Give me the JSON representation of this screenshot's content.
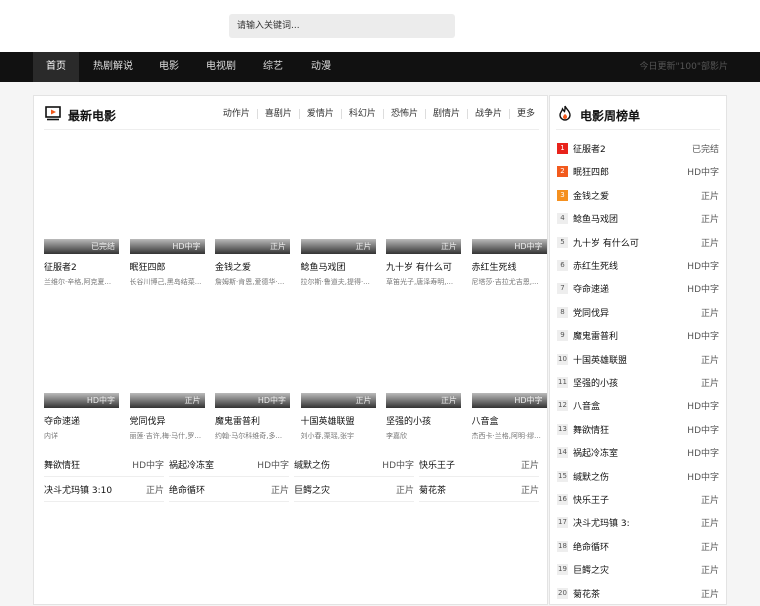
{
  "search": {
    "placeholder": "请输入关键词..."
  },
  "nav": {
    "items": [
      "首页",
      "热剧解说",
      "电影",
      "电视剧",
      "综艺",
      "动漫"
    ],
    "update_text": "今日更新\"100\"部影片"
  },
  "latest": {
    "title": "最新电影",
    "categories": [
      "动作片",
      "喜剧片",
      "爱情片",
      "科幻片",
      "恐怖片",
      "剧情片",
      "战争片",
      "更多"
    ],
    "cards": [
      {
        "title": "征服者2",
        "actors": "兰维尔·辛格,阿克夏...",
        "tag": "已完结"
      },
      {
        "title": "眠狂四郎",
        "actors": "长谷川博己,黑岛结菜...",
        "tag": "HD中字"
      },
      {
        "title": "金钱之爱",
        "actors": "詹姆斯·肯恩,爱德华·...",
        "tag": "正片"
      },
      {
        "title": "鲶鱼马戏团",
        "actors": "拉尔斯·鲁道夫,提得·...",
        "tag": "正片"
      },
      {
        "title": "九十岁 有什么可",
        "actors": "草笛光子,唐泽寿明,...",
        "tag": "正片"
      },
      {
        "title": "赤红生死线",
        "actors": "尼塔莎·吉拉尤吉恩,...",
        "tag": "HD中字"
      },
      {
        "title": "夺命速递",
        "actors": "内详",
        "tag": "HD中字"
      },
      {
        "title": "党同伐异",
        "actors": "丽莲·吉许,梅·马什,罗...",
        "tag": "正片"
      },
      {
        "title": "魔鬼雷普利",
        "actors": "约翰·马尔科维奇,多...",
        "tag": "HD中字"
      },
      {
        "title": "十国英雄联盟",
        "actors": "刘小春,栗瑶,张宇",
        "tag": "正片"
      },
      {
        "title": "坚强的小孩",
        "actors": "李嘉欣",
        "tag": "正片"
      },
      {
        "title": "八音盒",
        "actors": "杰西卡·兰格,阿明·缪...",
        "tag": "HD中字"
      }
    ],
    "list": [
      {
        "name": "舞欲情狂",
        "tag": "HD中字"
      },
      {
        "name": "祸起冷冻室",
        "tag": "HD中字"
      },
      {
        "name": "缄默之伤",
        "tag": "HD中字"
      },
      {
        "name": "快乐王子",
        "tag": "正片"
      },
      {
        "name": "决斗尤玛镇 3:10",
        "tag": "正片"
      },
      {
        "name": "绝命循环",
        "tag": "正片"
      },
      {
        "name": "巨鳄之灾",
        "tag": "正片"
      },
      {
        "name": "菊花茶",
        "tag": "正片"
      }
    ]
  },
  "ranking": {
    "title": "电影周榜单",
    "items": [
      {
        "rank": "1",
        "name": "征服者2",
        "tag": "已完结"
      },
      {
        "rank": "2",
        "name": "眠狂四郎",
        "tag": "HD中字"
      },
      {
        "rank": "3",
        "name": "金钱之爱",
        "tag": "正片"
      },
      {
        "rank": "4",
        "name": "鲶鱼马戏团",
        "tag": "正片"
      },
      {
        "rank": "5",
        "name": "九十岁 有什么可",
        "tag": "正片"
      },
      {
        "rank": "6",
        "name": "赤红生死线",
        "tag": "HD中字"
      },
      {
        "rank": "7",
        "name": "夺命速递",
        "tag": "HD中字"
      },
      {
        "rank": "8",
        "name": "党同伐异",
        "tag": "正片"
      },
      {
        "rank": "9",
        "name": "魔鬼雷普利",
        "tag": "HD中字"
      },
      {
        "rank": "10",
        "name": "十国英雄联盟",
        "tag": "正片"
      },
      {
        "rank": "11",
        "name": "坚强的小孩",
        "tag": "正片"
      },
      {
        "rank": "12",
        "name": "八音盒",
        "tag": "HD中字"
      },
      {
        "rank": "13",
        "name": "舞欲情狂",
        "tag": "HD中字"
      },
      {
        "rank": "14",
        "name": "祸起冷冻室",
        "tag": "HD中字"
      },
      {
        "rank": "15",
        "name": "缄默之伤",
        "tag": "HD中字"
      },
      {
        "rank": "16",
        "name": "快乐王子",
        "tag": "正片"
      },
      {
        "rank": "17",
        "name": "决斗尤玛镇 3:",
        "tag": "正片"
      },
      {
        "rank": "18",
        "name": "绝命循环",
        "tag": "正片"
      },
      {
        "rank": "19",
        "name": "巨鳄之灾",
        "tag": "正片"
      },
      {
        "rank": "20",
        "name": "菊花茶",
        "tag": "正片"
      }
    ],
    "top_colors": [
      "#e8231b",
      "#f25a1d",
      "#f5901f"
    ]
  }
}
